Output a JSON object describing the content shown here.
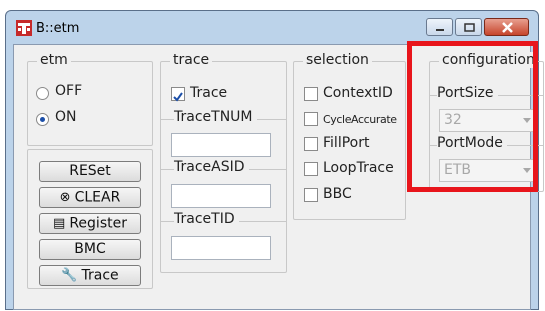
{
  "window": {
    "title": "B::etm",
    "icon": "trace32-icon"
  },
  "etm": {
    "title": "etm",
    "off_label": "OFF",
    "on_label": "ON",
    "selected": "ON"
  },
  "buttons": {
    "reset": "RESet",
    "clear": "CLEAR",
    "register": "Register",
    "bmc": "BMC",
    "trace": "Trace"
  },
  "trace": {
    "title": "trace",
    "trace_label": "Trace",
    "trace_checked": true,
    "tnum_label": "TraceTNUM",
    "tnum_value": "",
    "asid_label": "TraceASID",
    "asid_value": "",
    "tid_label": "TraceTID",
    "tid_value": ""
  },
  "selection": {
    "title": "selection",
    "context_id": "ContextID",
    "cycle_accurate": "CycleAccurate",
    "fill_port": "FillPort",
    "loop_trace": "LoopTrace",
    "bbc": "BBC"
  },
  "configuration": {
    "title": "configuration",
    "port_size_label": "PortSize",
    "port_size_value": "32",
    "port_mode_label": "PortMode",
    "port_mode_value": "ETB"
  },
  "colors": {
    "highlight": "#e8151b",
    "window_frame": "#bcd3ea",
    "radio_dot": "#1c4fa8"
  }
}
